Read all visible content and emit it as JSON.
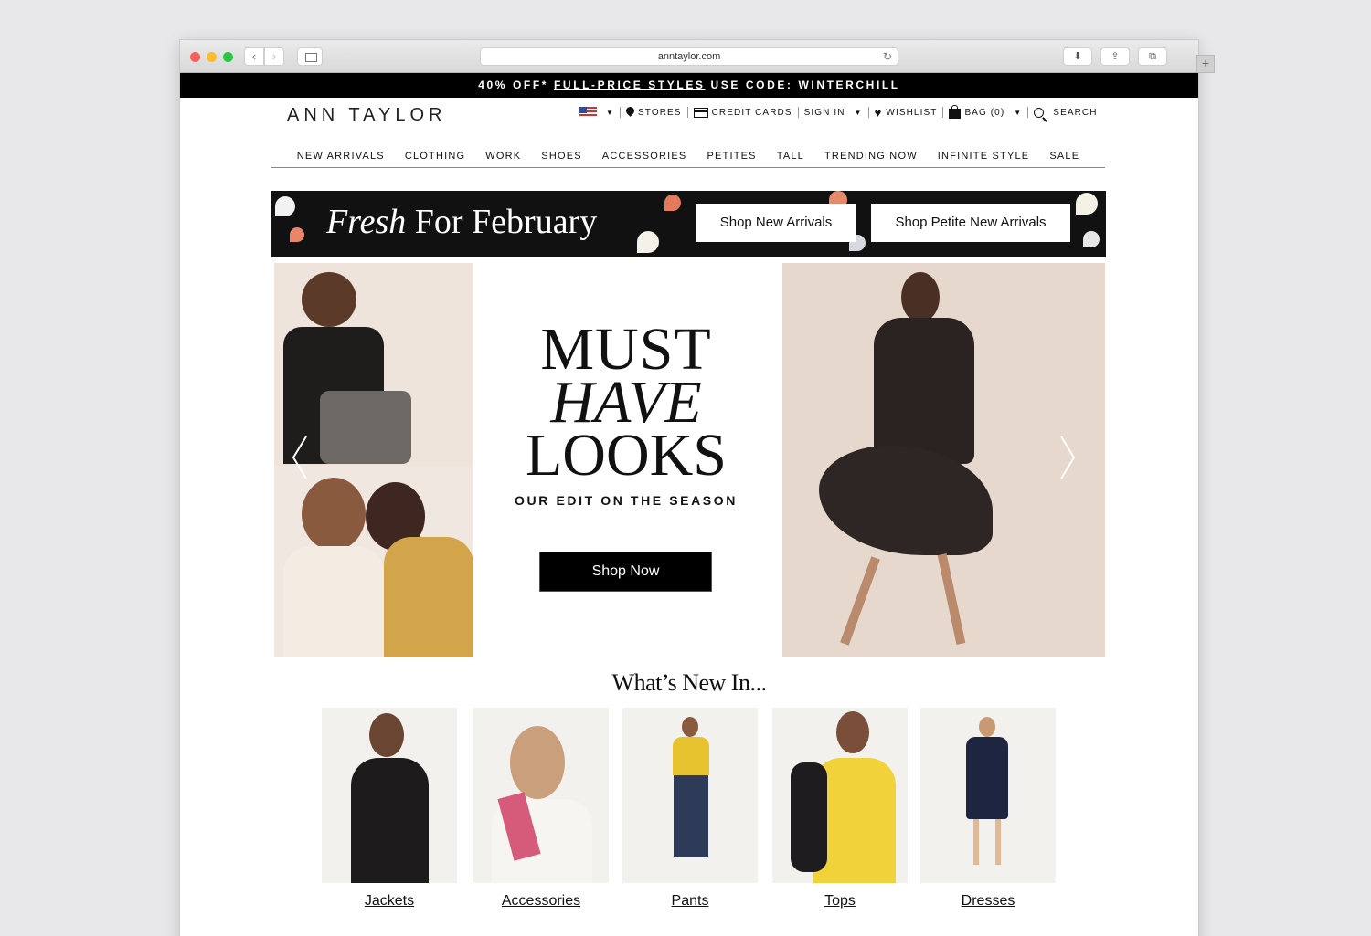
{
  "browser": {
    "url": "anntaylor.com",
    "reload_symbol": "↻",
    "download_symbol": "⬇",
    "share_symbol": "⇪",
    "tabs_symbol": "⧉",
    "newtab_symbol": "+",
    "back_symbol": "‹",
    "forward_symbol": "›"
  },
  "promo": {
    "prefix": "40% OFF* ",
    "link": "FULL-PRICE STYLES",
    "suffix": " USE CODE: WINTERCHILL"
  },
  "header": {
    "logo": "ANN TAYLOR",
    "utility": {
      "stores": "STORES",
      "credit_cards": "CREDIT CARDS",
      "sign_in": "SIGN IN",
      "wishlist": "WISHLIST",
      "bag": "BAG (0)",
      "search": "SEARCH",
      "caret": "▼"
    }
  },
  "nav": [
    "NEW ARRIVALS",
    "CLOTHING",
    "WORK",
    "SHOES",
    "ACCESSORIES",
    "PETITES",
    "TALL",
    "TRENDING NOW",
    "INFINITE STYLE",
    "SALE"
  ],
  "banner": {
    "title_italic": "Fresh",
    "title_rest": " For February",
    "button1": "Shop New Arrivals",
    "button2": "Shop Petite New Arrivals"
  },
  "hero": {
    "line1": "MUST",
    "line2": "HAVE",
    "line3": "LOOKS",
    "subtitle": "OUR EDIT ON THE SEASON",
    "cta": "Shop Now"
  },
  "whats_new": {
    "title": "What’s New In...",
    "categories": [
      "Jackets",
      "Accessories",
      "Pants",
      "Tops",
      "Dresses"
    ]
  },
  "colors": {
    "promo_bg": "#000000",
    "banner_bg": "#111111",
    "cta_bg": "#000000"
  }
}
